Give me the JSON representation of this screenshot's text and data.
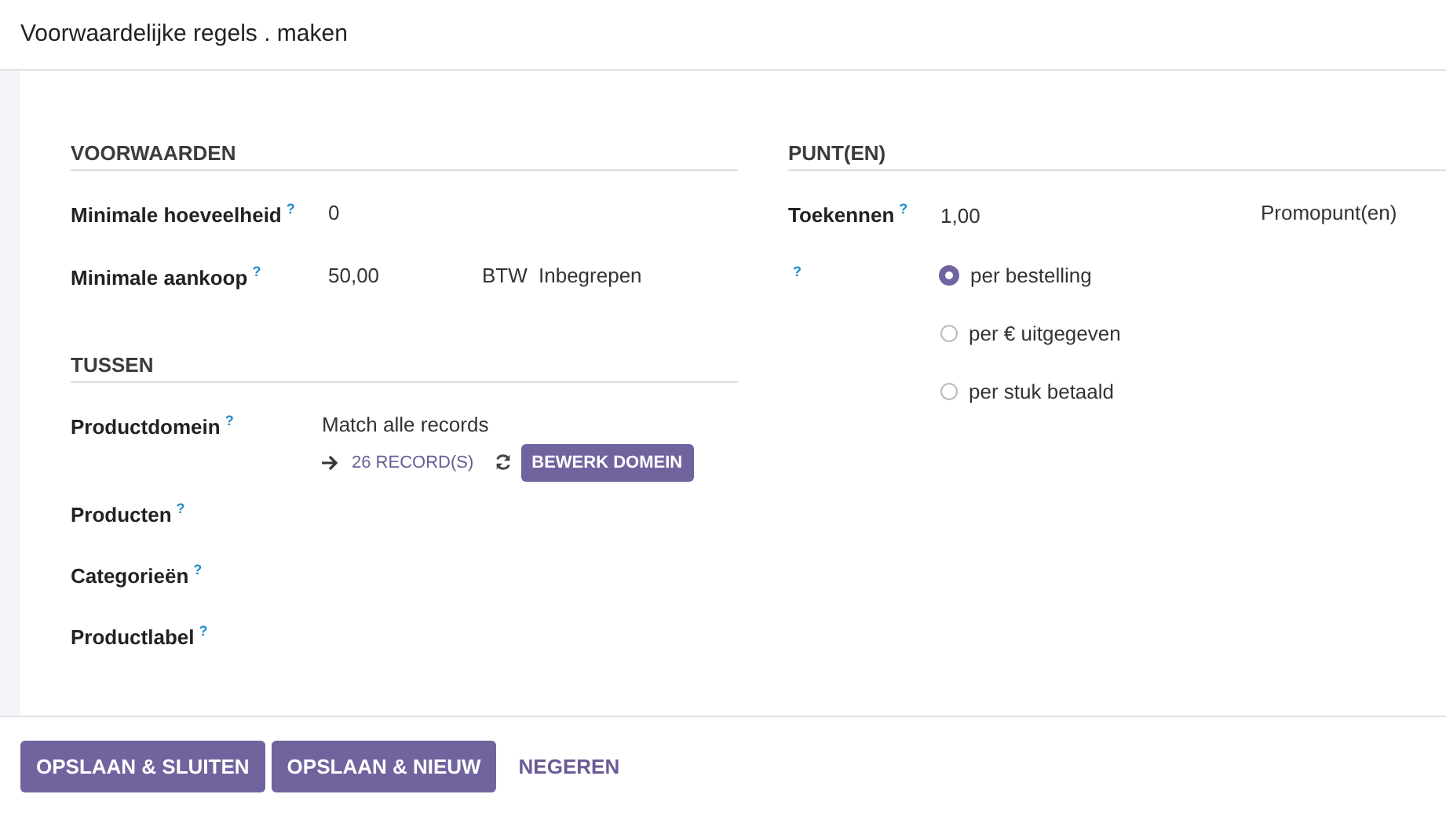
{
  "dialog": {
    "title": "Voorwaardelijke regels . maken"
  },
  "conditions": {
    "heading": "VOORWAARDEN",
    "fields": [
      {
        "label": "Minimale hoeveelheid",
        "help": "?",
        "value": "0"
      },
      {
        "label": "Minimale aankoop",
        "help": "?",
        "value": "50,00",
        "unit": "BTW",
        "tax": "Inbegrepen"
      }
    ]
  },
  "among": {
    "heading": "TUSSEN",
    "domain": {
      "label": "Productdomein",
      "help": "?",
      "summary": "Match alle records",
      "records_link": "26 RECORD(S)",
      "edit_button": "BEWERK DOMEIN"
    },
    "fields": [
      {
        "label": "Producten",
        "help": "?"
      },
      {
        "label": "Categorieën",
        "help": "?"
      },
      {
        "label": "Productlabel",
        "help": "?"
      }
    ]
  },
  "points": {
    "heading": "PUNT(EN)",
    "award": {
      "label": "Toekennen",
      "help": "?",
      "value": "1,00",
      "unit": "Promopunt(en)"
    },
    "mode_help": "?",
    "modes": [
      {
        "label": "per bestelling",
        "selected": true
      },
      {
        "label": "per € uitgegeven",
        "selected": false
      },
      {
        "label": "per stuk betaald",
        "selected": false
      }
    ]
  },
  "footer": {
    "buttons": [
      {
        "label": "OPSLAAN & SLUITEN",
        "kind": "primary"
      },
      {
        "label": "OPSLAAN & NIEUW",
        "kind": "primary"
      },
      {
        "label": "NEGEREN",
        "kind": "link"
      }
    ]
  }
}
